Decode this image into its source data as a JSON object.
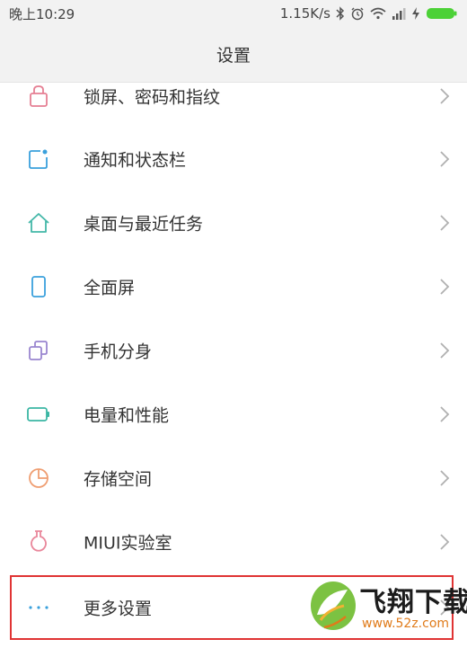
{
  "status_bar": {
    "time": "晚上10:29",
    "network_speed": "1.15K/s",
    "icons": [
      "bluetooth-icon",
      "alarm-icon",
      "wifi-icon",
      "signal-icon",
      "charging-icon",
      "battery-icon"
    ],
    "battery_color": "#4cd137"
  },
  "header": {
    "title": "设置"
  },
  "settings": {
    "items": [
      {
        "label": "锁屏、密码和指纹",
        "icon": "lock-icon",
        "color": "#e57f93"
      },
      {
        "label": "通知和状态栏",
        "icon": "notification-icon",
        "color": "#3aa0dc"
      },
      {
        "label": "桌面与最近任务",
        "icon": "home-icon",
        "color": "#43b7a8"
      },
      {
        "label": "全面屏",
        "icon": "phone-icon",
        "color": "#3aa0dc"
      },
      {
        "label": "手机分身",
        "icon": "dual-apps-icon",
        "color": "#9a86cf"
      },
      {
        "label": "电量和性能",
        "icon": "battery-performance-icon",
        "color": "#3bb6a4"
      },
      {
        "label": "存储空间",
        "icon": "storage-pie-icon",
        "color": "#ef9e72"
      },
      {
        "label": "MIUI实验室",
        "icon": "lab-flask-icon",
        "color": "#e9879b"
      },
      {
        "label": "更多设置",
        "icon": "more-dots-icon",
        "color": "#3aa0dc"
      }
    ]
  },
  "highlight_color": "#e03434",
  "watermark": {
    "brand": "飞翔下载",
    "url": "www.52z.com",
    "leaf_color": "#7cc242",
    "accent_color": "#e07b1a"
  }
}
